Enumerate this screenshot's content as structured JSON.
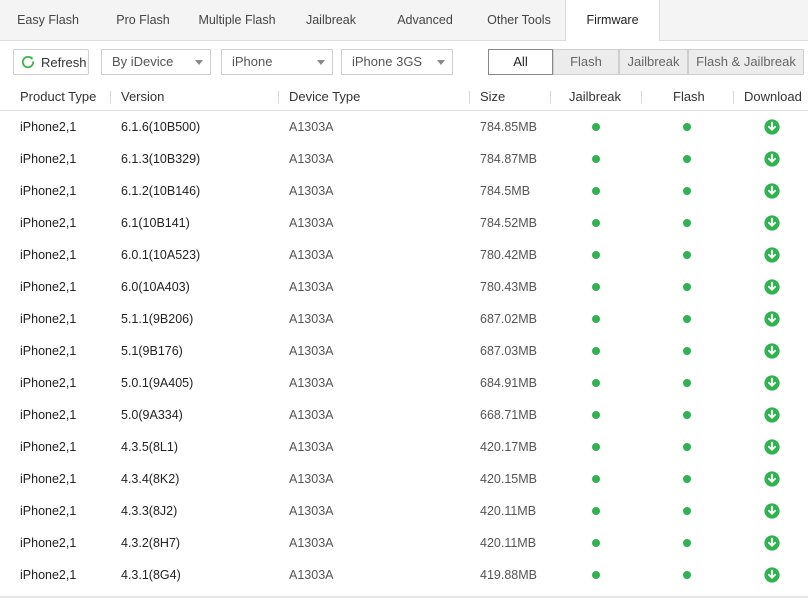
{
  "tabs": [
    {
      "label": "Easy Flash",
      "active": false
    },
    {
      "label": "Pro Flash",
      "active": false
    },
    {
      "label": "Multiple Flash",
      "active": false
    },
    {
      "label": "Jailbreak",
      "active": false
    },
    {
      "label": "Advanced",
      "active": false
    },
    {
      "label": "Other Tools",
      "active": false
    },
    {
      "label": "Firmware",
      "active": true
    }
  ],
  "toolbar": {
    "refresh_label": "Refresh",
    "refresh_icon": "refresh-icon",
    "filter_by": "By iDevice",
    "device_family": "iPhone",
    "device_model": "iPhone 3GS",
    "segments": [
      {
        "label": "All",
        "active": true
      },
      {
        "label": "Flash",
        "active": false
      },
      {
        "label": "Jailbreak",
        "active": false
      },
      {
        "label": "Flash & Jailbreak",
        "active": false
      }
    ]
  },
  "table": {
    "headers": [
      "Product Type",
      "Version",
      "Device Type",
      "Size",
      "Jailbreak",
      "Flash",
      "Download"
    ],
    "rows": [
      {
        "product": "iPhone2,1",
        "version": "6.1.6(10B500)",
        "device": "A1303A",
        "size": "784.85MB"
      },
      {
        "product": "iPhone2,1",
        "version": "6.1.3(10B329)",
        "device": "A1303A",
        "size": "784.87MB"
      },
      {
        "product": "iPhone2,1",
        "version": "6.1.2(10B146)",
        "device": "A1303A",
        "size": "784.5MB"
      },
      {
        "product": "iPhone2,1",
        "version": "6.1(10B141)",
        "device": "A1303A",
        "size": "784.52MB"
      },
      {
        "product": "iPhone2,1",
        "version": "6.0.1(10A523)",
        "device": "A1303A",
        "size": "780.42MB"
      },
      {
        "product": "iPhone2,1",
        "version": "6.0(10A403)",
        "device": "A1303A",
        "size": "780.43MB"
      },
      {
        "product": "iPhone2,1",
        "version": "5.1.1(9B206)",
        "device": "A1303A",
        "size": "687.02MB"
      },
      {
        "product": "iPhone2,1",
        "version": "5.1(9B176)",
        "device": "A1303A",
        "size": "687.03MB"
      },
      {
        "product": "iPhone2,1",
        "version": "5.0.1(9A405)",
        "device": "A1303A",
        "size": "684.91MB"
      },
      {
        "product": "iPhone2,1",
        "version": "5.0(9A334)",
        "device": "A1303A",
        "size": "668.71MB"
      },
      {
        "product": "iPhone2,1",
        "version": "4.3.5(8L1)",
        "device": "A1303A",
        "size": "420.17MB"
      },
      {
        "product": "iPhone2,1",
        "version": "4.3.4(8K2)",
        "device": "A1303A",
        "size": "420.15MB"
      },
      {
        "product": "iPhone2,1",
        "version": "4.3.3(8J2)",
        "device": "A1303A",
        "size": "420.11MB"
      },
      {
        "product": "iPhone2,1",
        "version": "4.3.2(8H7)",
        "device": "A1303A",
        "size": "420.11MB"
      },
      {
        "product": "iPhone2,1",
        "version": "4.3.1(8G4)",
        "device": "A1303A",
        "size": "419.88MB"
      }
    ],
    "status_color": "#2fb24f",
    "download_icon": "download-arrow-icon"
  }
}
